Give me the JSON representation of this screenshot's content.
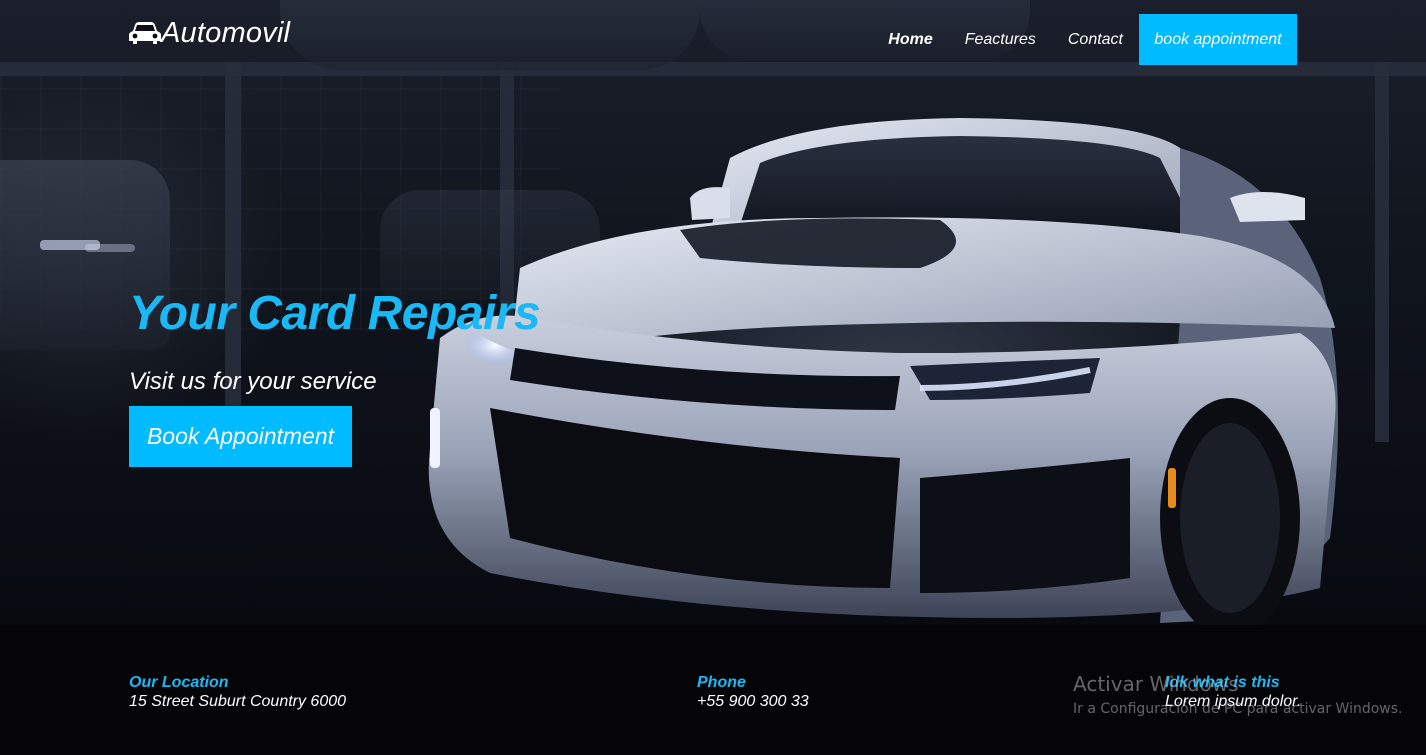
{
  "brand": {
    "name": "Automovil",
    "icon": "car-icon"
  },
  "nav": {
    "items": [
      {
        "label": "Home",
        "active": true
      },
      {
        "label": "Feactures",
        "active": false
      },
      {
        "label": "Contact",
        "active": false
      }
    ],
    "cta_label": "book appointment"
  },
  "hero": {
    "title": "Your Card Repairs",
    "subtitle": "Visit us for your service",
    "button_label": "Book Appointment"
  },
  "footer": {
    "location": {
      "title": "Our Location",
      "value": "15 Street Suburt Country 6000"
    },
    "phone": {
      "title": "Phone",
      "value": "+55 900 300 33"
    },
    "other": {
      "title": "Idk what is this",
      "value": "Lorem ipsum dolor."
    }
  },
  "watermark": {
    "line1": "Activar Windows",
    "line2": "Ir a Configuración de PC para activar Windows."
  },
  "colors": {
    "accent": "#00bbff",
    "accent_text": "#1ab8f5",
    "footer_bg": "#050507"
  }
}
